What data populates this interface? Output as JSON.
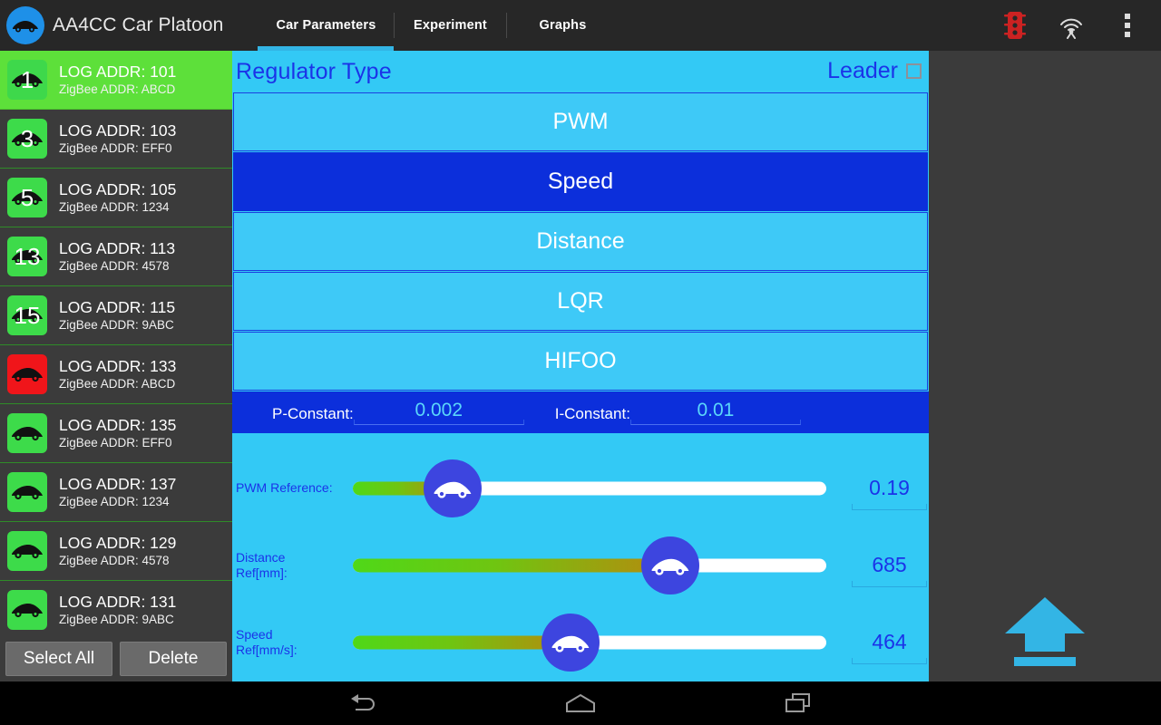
{
  "app": {
    "title": "AA4CC Car Platoon",
    "logo_icon": "car-logo-icon"
  },
  "tabs": [
    {
      "label": "Car Parameters",
      "active": true
    },
    {
      "label": "Experiment",
      "active": false
    },
    {
      "label": "Graphs",
      "active": false
    }
  ],
  "actionbar_icons": [
    {
      "name": "traffic-light-icon",
      "color": "#cc2222"
    },
    {
      "name": "antenna-signal-icon",
      "color": "#dcdcdc"
    },
    {
      "name": "overflow-menu-icon",
      "color": "#dcdcdc"
    }
  ],
  "sidebar": {
    "cars": [
      {
        "num": "1",
        "log": "LOG ADDR: 101",
        "zigbee": "ZigBee ADDR: ABCD",
        "color": "green",
        "selected": true
      },
      {
        "num": "3",
        "log": "LOG ADDR: 103",
        "zigbee": "ZigBee ADDR: EFF0",
        "color": "green",
        "selected": false
      },
      {
        "num": "5",
        "log": "LOG ADDR: 105",
        "zigbee": "ZigBee ADDR: 1234",
        "color": "green",
        "selected": false
      },
      {
        "num": "13",
        "log": "LOG ADDR: 113",
        "zigbee": "ZigBee ADDR: 4578",
        "color": "green",
        "selected": false
      },
      {
        "num": "15",
        "log": "LOG ADDR: 115",
        "zigbee": "ZigBee ADDR: 9ABC",
        "color": "green",
        "selected": false
      },
      {
        "num": "",
        "log": "LOG ADDR: 133",
        "zigbee": "ZigBee ADDR: ABCD",
        "color": "red",
        "selected": false
      },
      {
        "num": "",
        "log": "LOG ADDR: 135",
        "zigbee": "ZigBee ADDR: EFF0",
        "color": "green",
        "selected": false
      },
      {
        "num": "",
        "log": "LOG ADDR: 137",
        "zigbee": "ZigBee ADDR: 1234",
        "color": "green",
        "selected": false
      },
      {
        "num": "",
        "log": "LOG ADDR: 129",
        "zigbee": "ZigBee ADDR: 4578",
        "color": "green",
        "selected": false
      },
      {
        "num": "",
        "log": "LOG ADDR: 131",
        "zigbee": "ZigBee ADDR: 9ABC",
        "color": "green",
        "selected": false
      }
    ],
    "select_all_label": "Select All",
    "delete_label": "Delete"
  },
  "main": {
    "regulator_title": "Regulator Type",
    "leader_label": "Leader",
    "leader_checked": false,
    "regulators": [
      {
        "label": "PWM",
        "active": false
      },
      {
        "label": "Speed",
        "active": true
      },
      {
        "label": "Distance",
        "active": false
      },
      {
        "label": "LQR",
        "active": false
      },
      {
        "label": "HIFOO",
        "active": false
      }
    ],
    "constants": [
      {
        "label": "P-Constant:",
        "value": "0.002"
      },
      {
        "label": "I-Constant:",
        "value": "0.01"
      }
    ],
    "sliders": [
      {
        "label": "PWM Reference:",
        "value": "0.19",
        "percent": 21
      },
      {
        "label": "Distance\nRef[mm]:",
        "value": "685",
        "percent": 67
      },
      {
        "label": "Speed\nRef[mm/s]:",
        "value": "464",
        "percent": 46
      }
    ]
  },
  "right_panel": {
    "upload_icon": "upload-arrow-icon",
    "accent": "#33b5e5"
  },
  "navbar": [
    {
      "name": "back-icon"
    },
    {
      "name": "home-icon"
    },
    {
      "name": "recents-icon"
    }
  ]
}
